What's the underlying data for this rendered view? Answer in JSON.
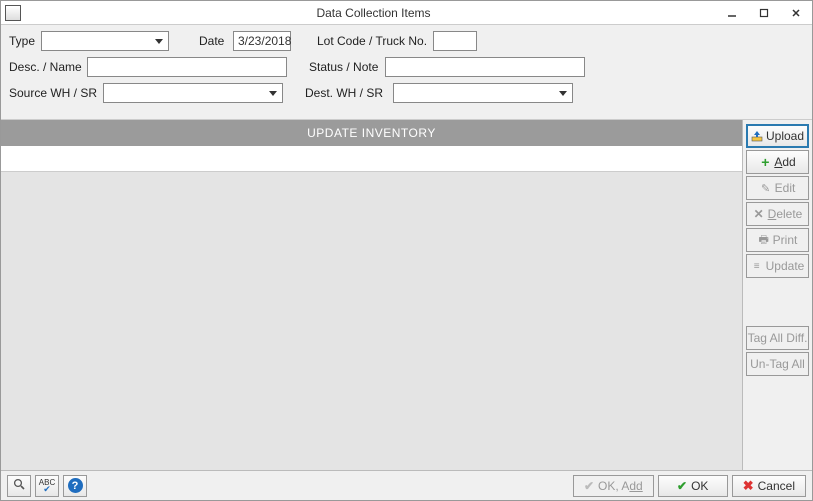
{
  "window": {
    "title": "Data Collection Items"
  },
  "form": {
    "type_label": "Type",
    "type_value": "",
    "date_label": "Date",
    "date_value": "3/23/2018",
    "lot_label": "Lot Code / Truck No.",
    "lot_value": "",
    "desc_label": "Desc. / Name",
    "desc_value": "",
    "status_label": "Status / Note",
    "status_value": "",
    "source_label": "Source WH / SR",
    "source_value": "",
    "dest_label": "Dest. WH / SR",
    "dest_value": ""
  },
  "grid": {
    "update_banner": "UPDATE INVENTORY"
  },
  "sidebar": {
    "upload": "Upload",
    "add_prefix": "A",
    "add_suffix": "dd",
    "edit": "Edit",
    "delete_prefix": "D",
    "delete_suffix": "elete",
    "print": "Print",
    "update": "Update",
    "tag_all_diff": "Tag All Diff.",
    "untag_all": "Un-Tag All"
  },
  "footer": {
    "ok_add": "OK, A",
    "ok_add_suffix": "dd",
    "ok": "OK",
    "cancel": "Cancel"
  }
}
